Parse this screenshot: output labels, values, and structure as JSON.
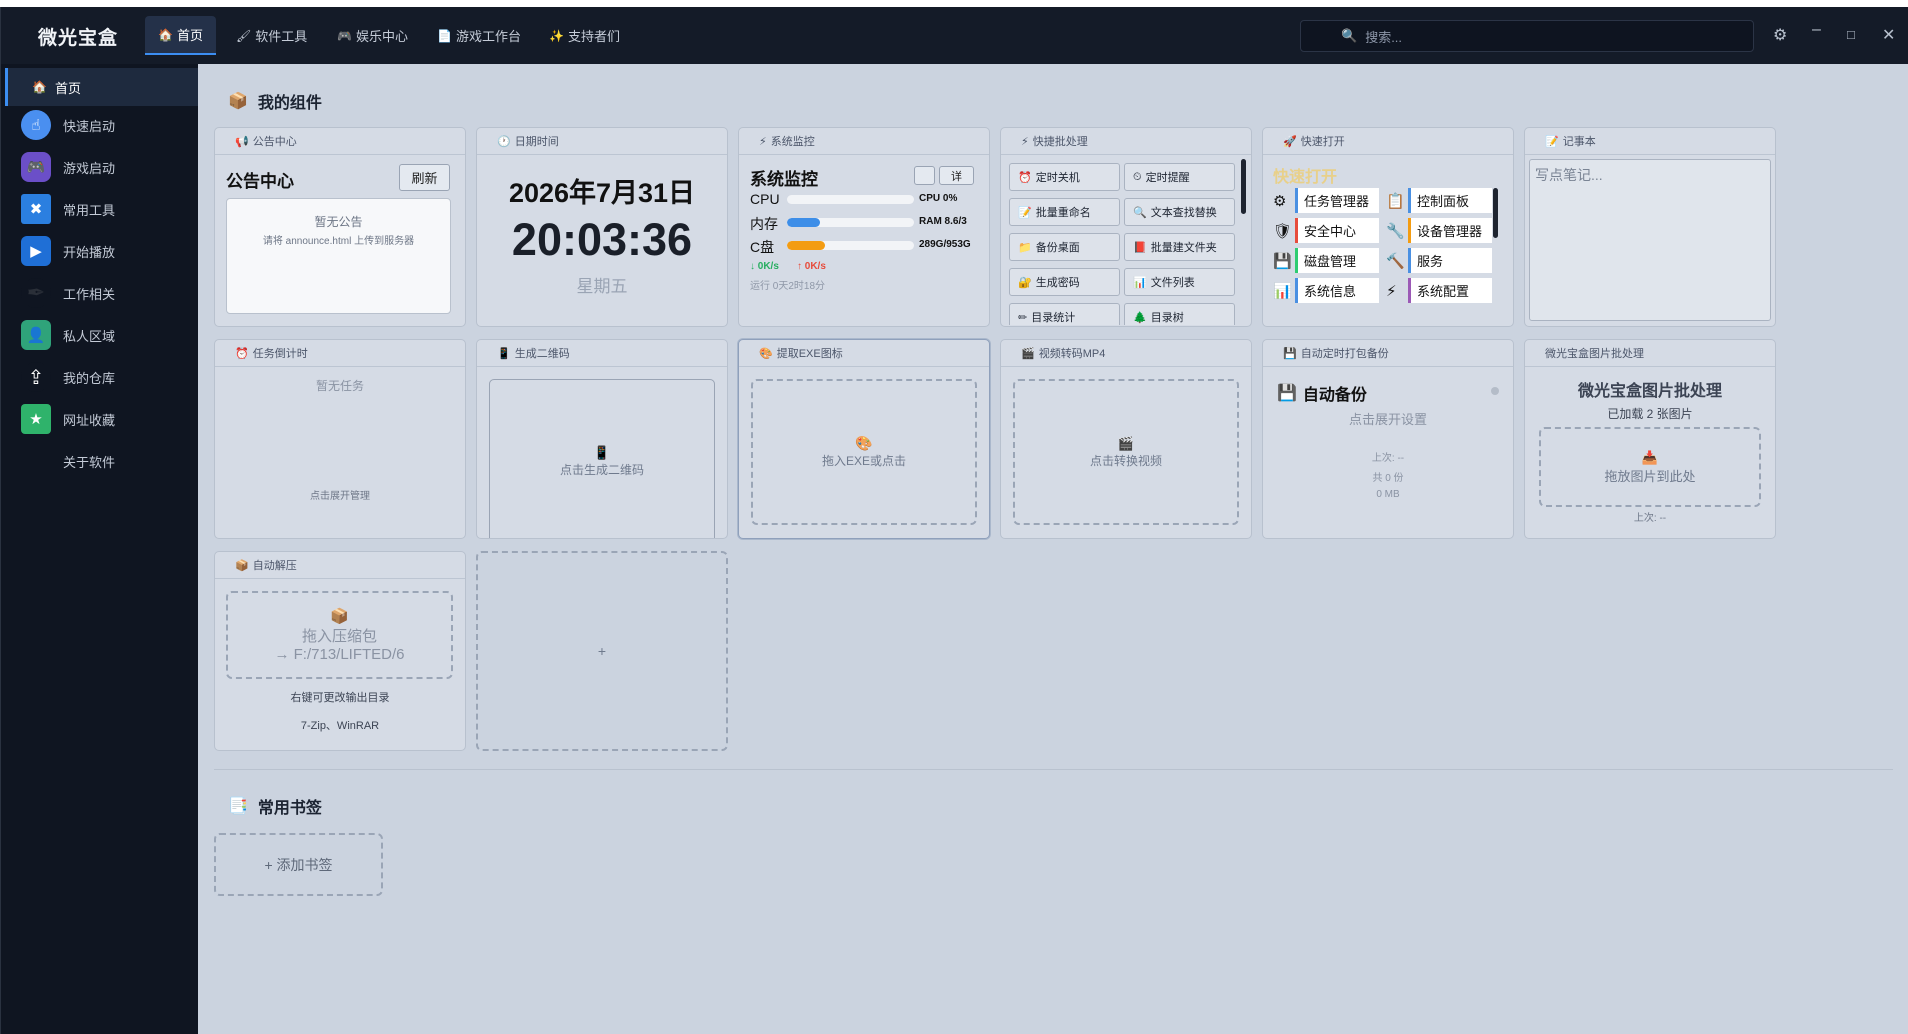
{
  "app": {
    "title": "微光宝盒"
  },
  "tabs": [
    {
      "icon": "🏠",
      "label": "首页"
    },
    {
      "icon": "🖌",
      "label": "软件工具"
    },
    {
      "icon": "🎮",
      "label": "娱乐中心"
    },
    {
      "icon": "📄",
      "label": "游戏工作台"
    },
    {
      "icon": "✨",
      "label": "支持者们"
    }
  ],
  "search": {
    "placeholder": "搜索..."
  },
  "sidebar": {
    "items": [
      {
        "label": "首页",
        "icon": "home-icon",
        "color": ""
      },
      {
        "label": "快速启动",
        "icon": "hand-icon",
        "color": "#4a8ff0"
      },
      {
        "label": "游戏启动",
        "icon": "gamepad-icon",
        "color": "#7a5cd6"
      },
      {
        "label": "常用工具",
        "icon": "tools-icon",
        "color": "#2b7fe0"
      },
      {
        "label": "开始播放",
        "icon": "play-icon",
        "color": "#1f6fd6"
      },
      {
        "label": "工作相关",
        "icon": "feather-icon",
        "color": "#2a2f38"
      },
      {
        "label": "私人区域",
        "icon": "person-icon",
        "color": "#2fa37a"
      },
      {
        "label": "我的仓库",
        "icon": "upload-icon",
        "color": ""
      },
      {
        "label": "网址收藏",
        "icon": "star-icon",
        "color": "#2fb36b"
      },
      {
        "label": "关于软件",
        "icon": "",
        "color": ""
      }
    ]
  },
  "widgets_title": "我的组件",
  "announce": {
    "head": "公告中心",
    "title": "公告中心",
    "refresh": "刷新",
    "empty": "暂无公告",
    "hint": "请将 announce.html 上传到服务器"
  },
  "datetime": {
    "head": "日期时间",
    "date": "2026年7月31日",
    "time": "20:03:36",
    "weekday": "星期五"
  },
  "sysmon": {
    "head": "系统监控",
    "title": "系统监控",
    "btn": "详",
    "rows": [
      {
        "label": "CPU",
        "value": "CPU 0%",
        "pct": 0,
        "color": "#4a90e2"
      },
      {
        "label": "内存",
        "value": "RAM 8.6/3",
        "pct": 26,
        "color": "#3d8ee8"
      },
      {
        "label": "C盘",
        "value": "289G/953G",
        "pct": 30,
        "color": "#f39c12"
      }
    ],
    "down": "↓ 0K/s",
    "up": "↑ 0K/s",
    "uptime": "运行 0天2时18分"
  },
  "batch": {
    "head": "快捷批处理",
    "items": [
      {
        "icon": "⏰",
        "label": "定时关机"
      },
      {
        "icon": "⏲",
        "label": "定时提醒"
      },
      {
        "icon": "📝",
        "label": "批量重命名"
      },
      {
        "icon": "🔍",
        "label": "文本查找替换"
      },
      {
        "icon": "📁",
        "label": "备份桌面"
      },
      {
        "icon": "📕",
        "label": "批量建文件夹"
      },
      {
        "icon": "🔐",
        "label": "生成密码"
      },
      {
        "icon": "📊",
        "label": "文件列表"
      },
      {
        "icon": "✏",
        "label": "目录统计"
      },
      {
        "icon": "🌲",
        "label": "目录树"
      }
    ]
  },
  "quickopen": {
    "head": "快速打开",
    "title": "快速打开",
    "items": [
      {
        "icon": "⚙",
        "label": "任务管理器",
        "color": "#4a90e2"
      },
      {
        "icon": "📋",
        "label": "控制面板",
        "color": "#4a90e2"
      },
      {
        "icon": "🛡",
        "label": "安全中心",
        "color": "#e74c3c"
      },
      {
        "icon": "🔧",
        "label": "设备管理器",
        "color": "#f39c12"
      },
      {
        "icon": "💾",
        "label": "磁盘管理",
        "color": "#2ecc71"
      },
      {
        "icon": "🔨",
        "label": "服务",
        "color": "#4a90e2"
      },
      {
        "icon": "📊",
        "label": "系统信息",
        "color": "#4a90e2"
      },
      {
        "icon": "⚡",
        "label": "系统配置",
        "color": "#9b59b6"
      }
    ]
  },
  "notes": {
    "head": "记事本",
    "placeholder": "写点笔记..."
  },
  "countdown": {
    "head": "任务倒计时",
    "empty": "暂无任务",
    "manage": "点击展开管理"
  },
  "qrcode": {
    "head": "生成二维码",
    "hint": "点击生成二维码"
  },
  "exeicon": {
    "head": "提取EXE图标",
    "hint": "拖入EXE或点击"
  },
  "video": {
    "head": "视频转码MP4",
    "hint": "点击转换视频"
  },
  "backup": {
    "head": "自动定时打包备份",
    "title": "自动备份",
    "setup": "点击展开设置",
    "last": "上次: --",
    "count": "共 0 份",
    "size": "0 MB"
  },
  "imgbatch": {
    "head": "微光宝盒图片批处理",
    "title": "微光宝盒图片批处理",
    "loaded": "已加载 2 张图片",
    "drop": "拖放图片到此处",
    "last": "上次: --"
  },
  "unzip": {
    "head": "自动解压",
    "drop1": "拖入压缩包",
    "drop2": "→ F:/713/LIFTED/6",
    "hint": "右键可更改输出目录",
    "tools": "7-Zip、WinRAR"
  },
  "add_widget": "+",
  "bookmarks_title": "常用书签",
  "add_bookmark": "+ 添加书签"
}
